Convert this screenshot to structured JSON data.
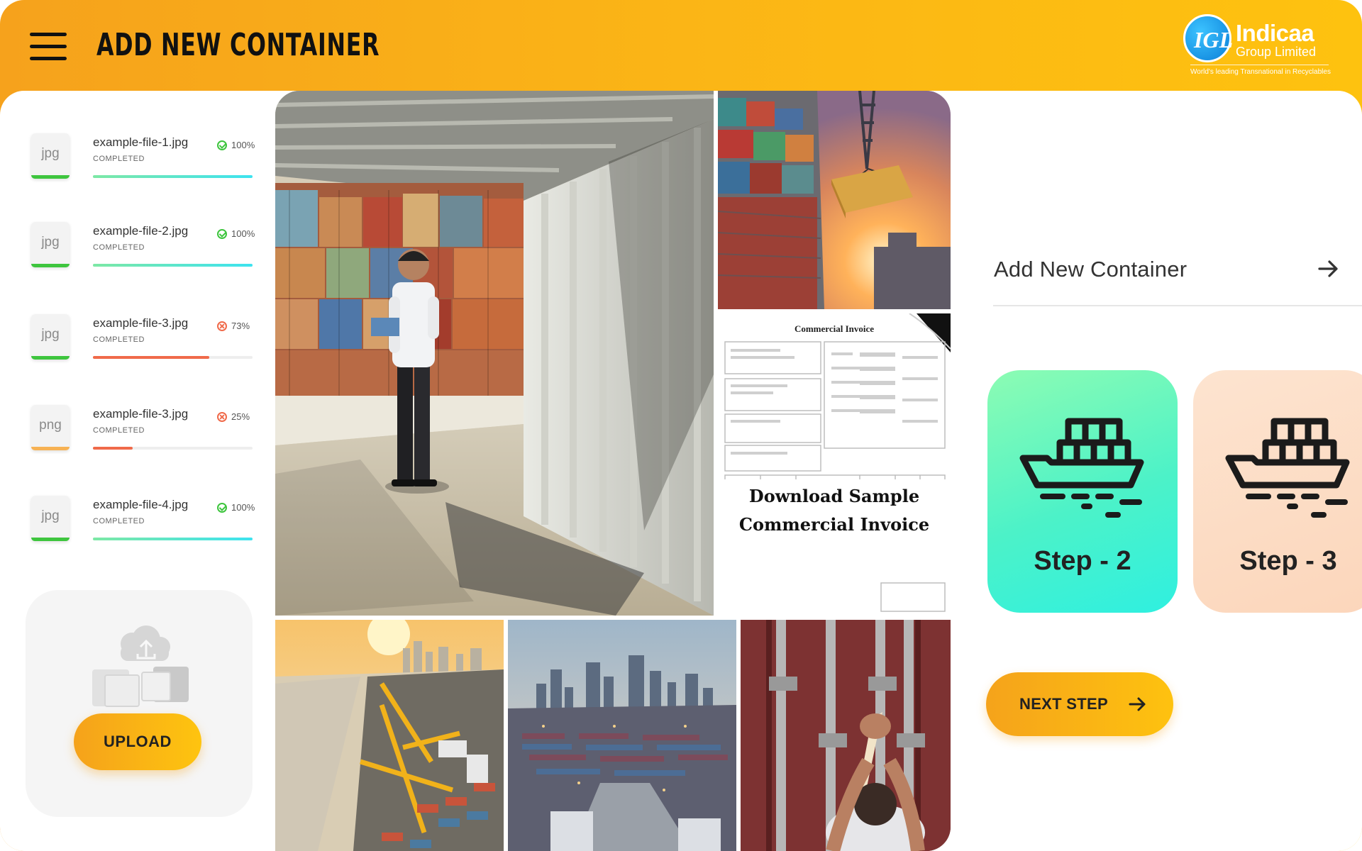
{
  "header": {
    "title": "ADD NEW CONTAINER",
    "logo": {
      "mark_text": "IGL",
      "name": "Indicaa",
      "sub": "Group Limited",
      "tagline": "World's leading Transnational in Recyclables"
    }
  },
  "files": [
    {
      "ext": "jpg",
      "name": "example-file-1.jpg",
      "status": "COMPLETED",
      "percent_label": "100%",
      "percent": 100,
      "state": "ok"
    },
    {
      "ext": "jpg",
      "name": "example-file-2.jpg",
      "status": "COMPLETED",
      "percent_label": "100%",
      "percent": 100,
      "state": "ok"
    },
    {
      "ext": "jpg",
      "name": "example-file-3.jpg",
      "status": "COMPLETED",
      "percent_label": "73%",
      "percent": 73,
      "state": "error"
    },
    {
      "ext": "png",
      "name": "example-file-3.jpg",
      "status": "COMPLETED",
      "percent_label": "25%",
      "percent": 25,
      "state": "error"
    },
    {
      "ext": "jpg",
      "name": "example-file-4.jpg",
      "status": "COMPLETED",
      "percent_label": "100%",
      "percent": 100,
      "state": "ok"
    }
  ],
  "upload": {
    "button_label": "UPLOAD"
  },
  "gallery": {
    "invoice_title": "Commercial Invoice",
    "invoice_caption_line1": "Download Sample",
    "invoice_caption_line2": "Commercial Invoice"
  },
  "action": {
    "label": "Add New Container"
  },
  "steps": [
    {
      "label": "Step - 2"
    },
    {
      "label": "Step - 3"
    }
  ],
  "next_button": {
    "label": "NEXT STEP"
  },
  "colors": {
    "header_start": "#f6a21c",
    "header_end": "#fec20f",
    "success": "#3ec53e",
    "error": "#f06a4a",
    "progress_ok_start": "#7de8a5",
    "progress_ok_end": "#3de3f0",
    "step2": "#4cf2c8",
    "step3": "#fcd6bb"
  }
}
